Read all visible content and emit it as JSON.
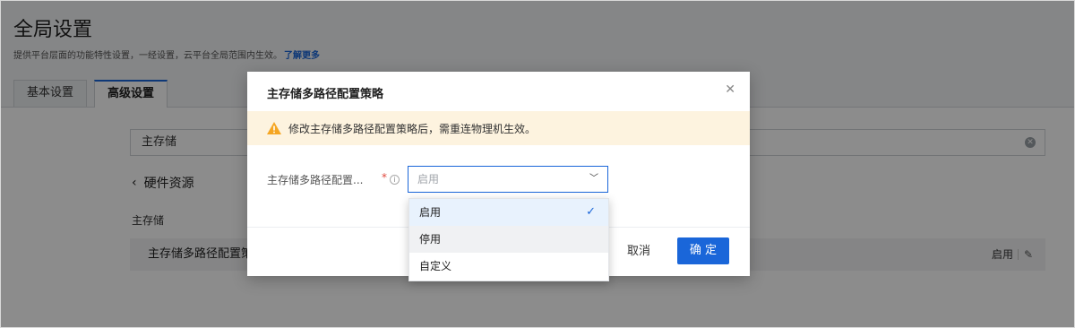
{
  "page": {
    "title": "全局设置",
    "subtitle": "提供平台层面的功能特性设置，一经设置，云平台全局范围内生效。",
    "learn_more": "了解更多",
    "tabs": [
      {
        "label": "基本设置",
        "active": false
      },
      {
        "label": "高级设置",
        "active": true
      }
    ],
    "search_value": "主存储",
    "back_label": "硬件资源",
    "section_label": "主存储",
    "setting_row": {
      "name": "主存储多路径配置策",
      "value": "启用"
    }
  },
  "modal": {
    "title": "主存储多路径配置策略",
    "warning": "修改主存储多路径配置策略后，需重连物理机生效。",
    "field_label": "主存储多路径配置...",
    "required_mark": "*",
    "select_placeholder": "启用",
    "cancel_label": "取消",
    "ok_label": "确 定"
  },
  "dropdown": {
    "options": [
      {
        "label": "启用",
        "selected": true
      },
      {
        "label": "停用",
        "selected": false
      },
      {
        "label": "自定义",
        "selected": false
      }
    ]
  },
  "colors": {
    "accent": "#1a66d9",
    "warning_bg": "#fdf3df",
    "warning_icon": "#f5a623",
    "required": "#e0473d"
  },
  "icons": {
    "close": "close-icon",
    "warning": "warning-icon",
    "info": "info-icon",
    "chevron_left": "chevron-left-icon",
    "chevron_down": "chevron-down-icon",
    "check": "check-icon",
    "edit": "edit-icon",
    "clear": "clear-icon"
  }
}
